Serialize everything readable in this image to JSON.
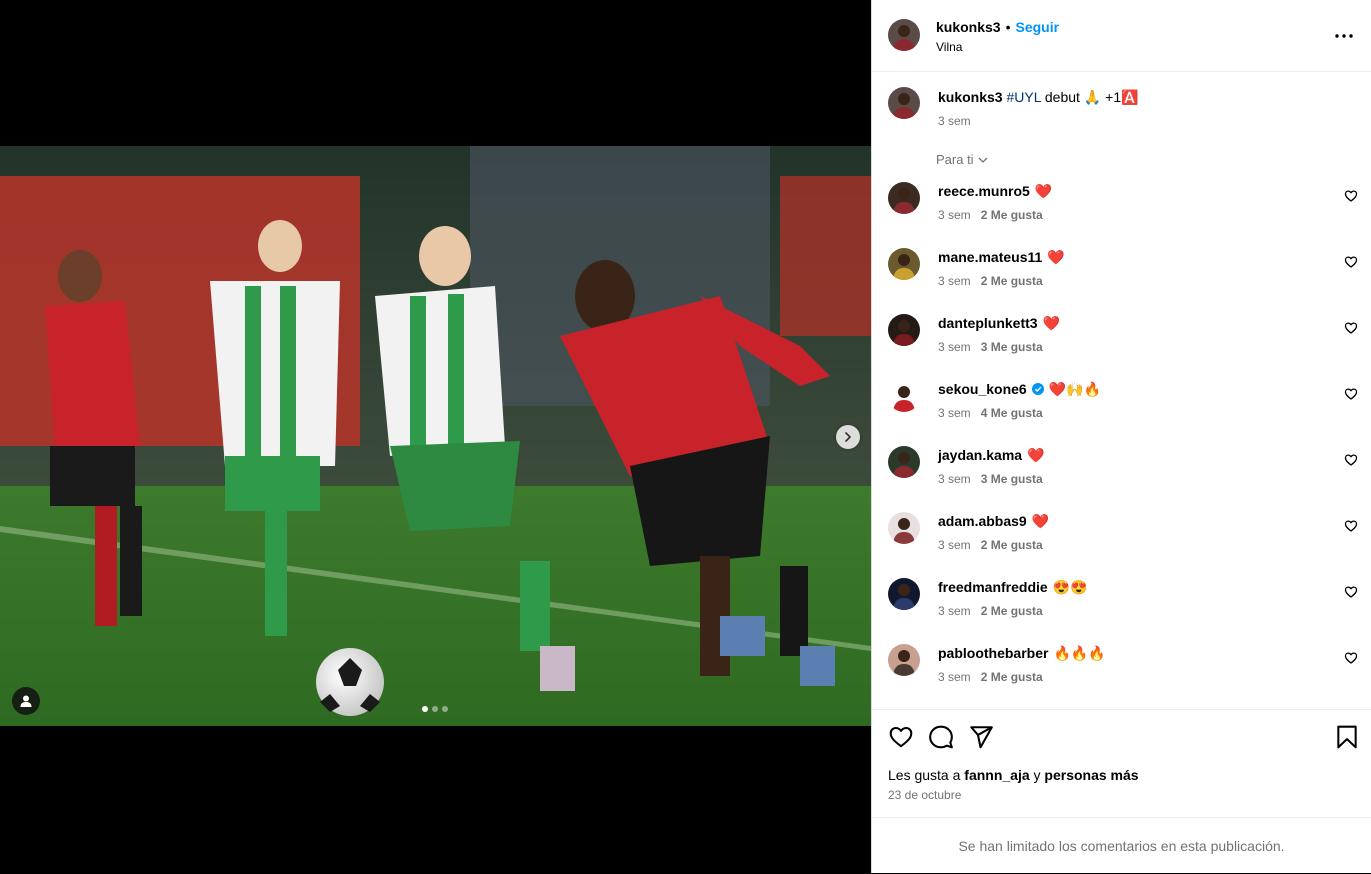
{
  "post": {
    "author": "kukonks3",
    "follow_label": "Seguir",
    "location": "Vilna",
    "media_dots": 3,
    "media_active_index": 0
  },
  "caption": {
    "username": "kukonks3",
    "hashtag": "#UYL",
    "text": "debut",
    "emoji": "🙏",
    "suffix": "+1🅰️",
    "time": "3 sem"
  },
  "comments_filter": "Para ti",
  "comments": [
    {
      "username": "reece.munro5",
      "text": "❤️",
      "time": "3 sem",
      "likes": "2 Me gusta",
      "verified": false
    },
    {
      "username": "mane.mateus11",
      "text": "❤️",
      "time": "3 sem",
      "likes": "2 Me gusta",
      "verified": false
    },
    {
      "username": "danteplunkett3",
      "text": "❤️",
      "time": "3 sem",
      "likes": "3 Me gusta",
      "verified": false
    },
    {
      "username": "sekou_kone6",
      "text": "❤️🙌🔥",
      "time": "3 sem",
      "likes": "4 Me gusta",
      "verified": true
    },
    {
      "username": "jaydan.kama",
      "text": "❤️",
      "time": "3 sem",
      "likes": "3 Me gusta",
      "verified": false
    },
    {
      "username": "adam.abbas9",
      "text": "❤️",
      "time": "3 sem",
      "likes": "2 Me gusta",
      "verified": false
    },
    {
      "username": "freedmanfreddie",
      "text": "😍😍",
      "time": "3 sem",
      "likes": "2 Me gusta",
      "verified": false
    },
    {
      "username": "pabloothebarber",
      "text": "🔥🔥🔥",
      "time": "3 sem",
      "likes": "2 Me gusta",
      "verified": false
    }
  ],
  "likes": {
    "prefix": "Les gusta a",
    "user": "fannn_aja",
    "joiner": "y",
    "rest": "personas más"
  },
  "post_date": "23 de octubre",
  "comments_limited": "Se han limitado los comentarios en esta publicación.",
  "icons": {
    "like": "heart-icon",
    "comment": "comment-icon",
    "share": "send-icon",
    "save": "bookmark-icon",
    "more": "more-icon",
    "next": "chevron-right-icon",
    "tag": "user-tag-icon",
    "verified": "verified-badge-icon"
  },
  "colors": {
    "accent": "#0095f6",
    "heart": "#e41e3f",
    "verified": "#0095f6",
    "hashtag": "#00376b",
    "muted": "#737373"
  }
}
